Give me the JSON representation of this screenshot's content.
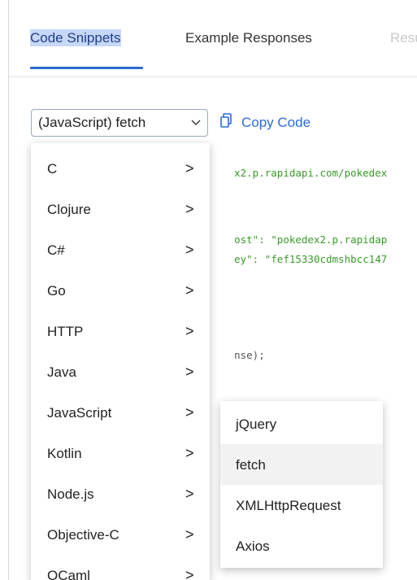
{
  "tabs": [
    {
      "label": "Code Snippets",
      "active": true
    },
    {
      "label": "Example Responses",
      "active": false
    },
    {
      "label": "Resu",
      "active": false
    }
  ],
  "snippet": {
    "selected_language": "(JavaScript) fetch",
    "copy_label": "Copy Code",
    "code_lines": [
      {
        "parts": [
          {
            "t": "x2.p.rapidapi.com/pokedex",
            "c": "str"
          }
        ]
      },
      {
        "parts": [
          {
            "t": "ost\": \"pokedex2.p.rapidap",
            "c": "str"
          }
        ]
      },
      {
        "parts": [
          {
            "t": "ey\": \"fef15330cdmshbcc147",
            "c": "str"
          }
        ]
      },
      {
        "parts": [
          {
            "t": "nse);",
            "c": "plain"
          }
        ]
      },
      {
        "parts": [
          {
            "t": ")",
            "c": "plain"
          }
        ]
      }
    ]
  },
  "language_menu": {
    "items": [
      {
        "label": "C"
      },
      {
        "label": "Clojure"
      },
      {
        "label": "C#"
      },
      {
        "label": "Go"
      },
      {
        "label": "HTTP"
      },
      {
        "label": "Java"
      },
      {
        "label": "JavaScript"
      },
      {
        "label": "Kotlin"
      },
      {
        "label": "Node.js"
      },
      {
        "label": "Objective-C"
      },
      {
        "label": "OCaml"
      }
    ],
    "arrow_glyph": ">"
  },
  "javascript_submenu": {
    "items": [
      {
        "label": "jQuery",
        "selected": false
      },
      {
        "label": "fetch",
        "selected": true
      },
      {
        "label": "XMLHttpRequest",
        "selected": false
      },
      {
        "label": "Axios",
        "selected": false
      }
    ]
  },
  "colors": {
    "accent": "#2c6cd6",
    "code_string": "#3a9a2a",
    "tab_highlight": "#c7d7f7"
  },
  "icons": {
    "copy": "copy-icon",
    "select_caret": "chevron-down-icon",
    "submenu_arrow": "chevron-right-icon"
  }
}
